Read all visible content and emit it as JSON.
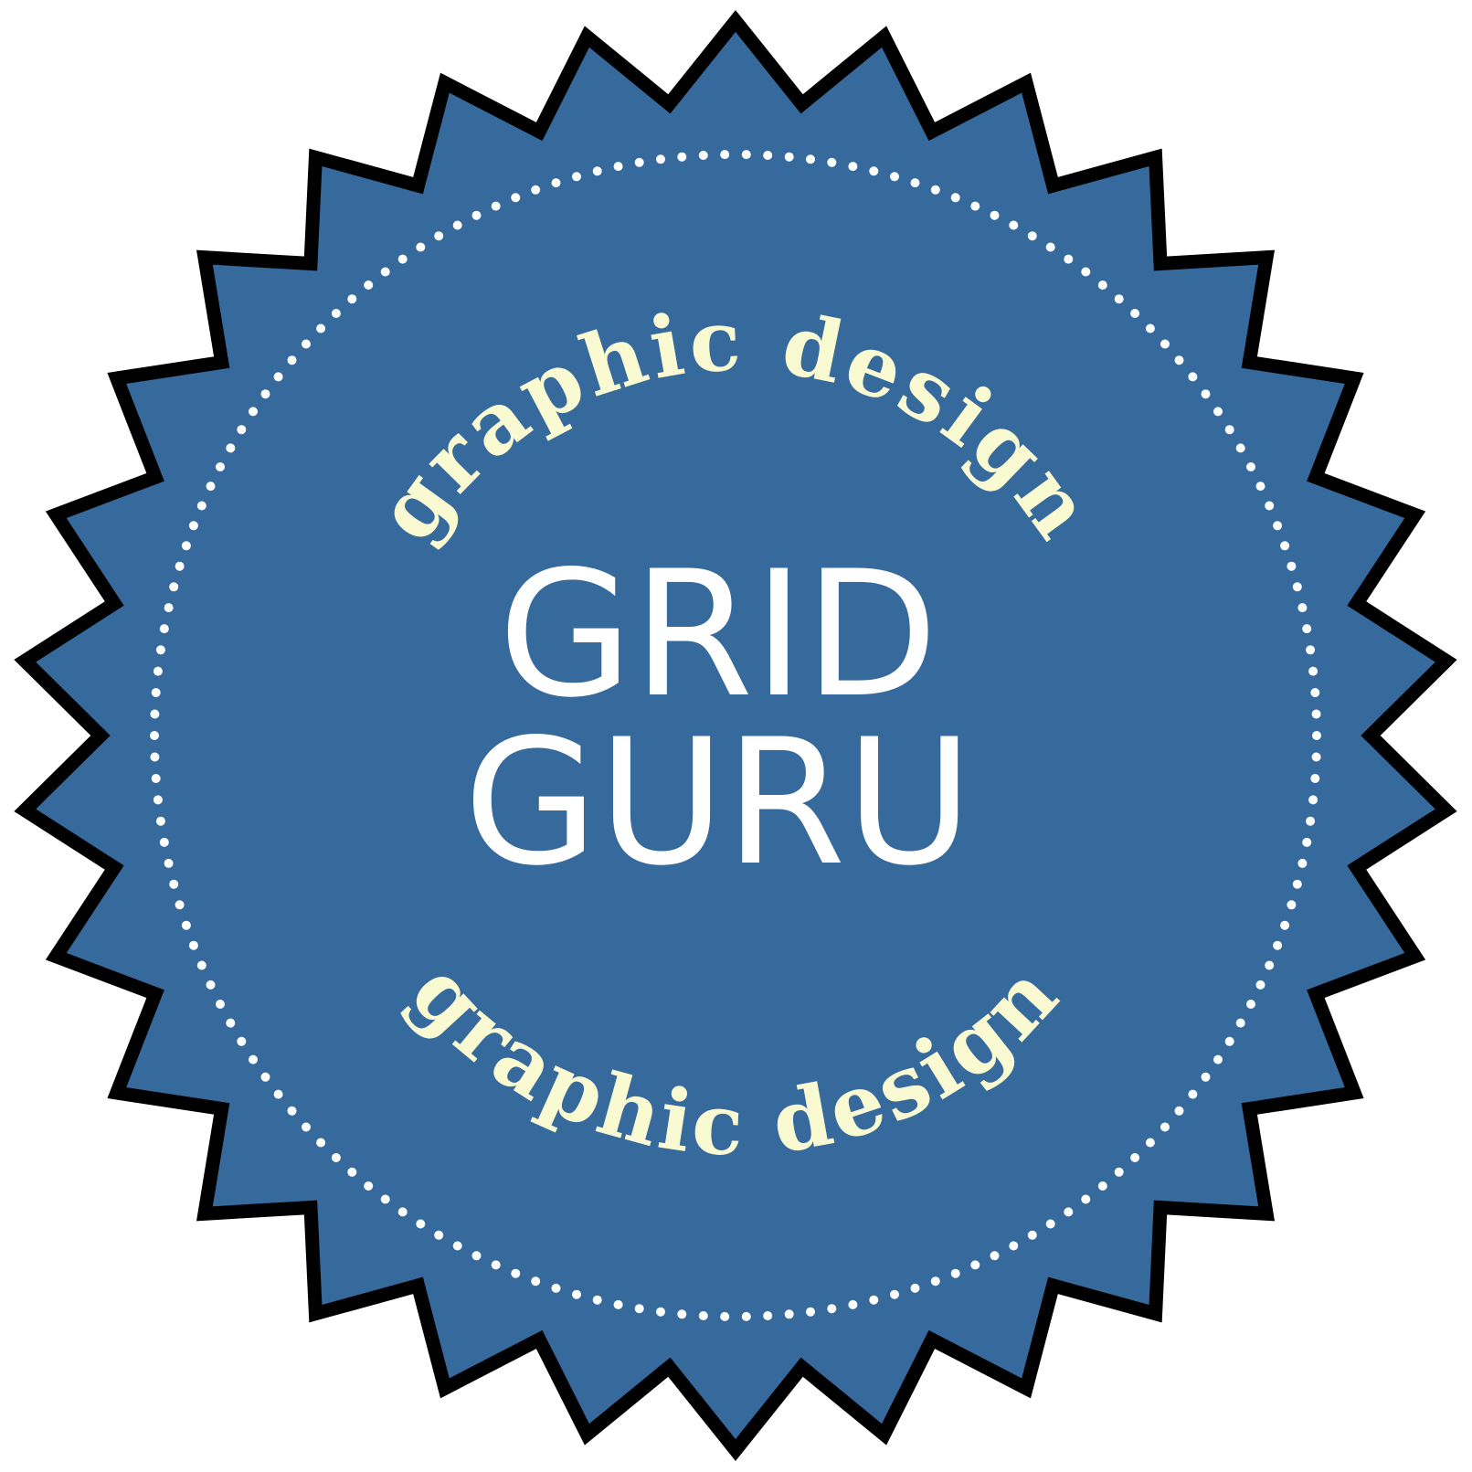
{
  "badge": {
    "top_arc_text": "graphic design",
    "bottom_arc_text": "graphic design",
    "title_line_1": "GRID",
    "title_line_2": "GURU",
    "star_points": 30,
    "colors": {
      "background": "#ffffff",
      "badge_fill": "#36699c",
      "outline": "#000000",
      "arc_text": "#fafad2",
      "title_text": "#ffffff",
      "dots": "#ffffff"
    }
  }
}
